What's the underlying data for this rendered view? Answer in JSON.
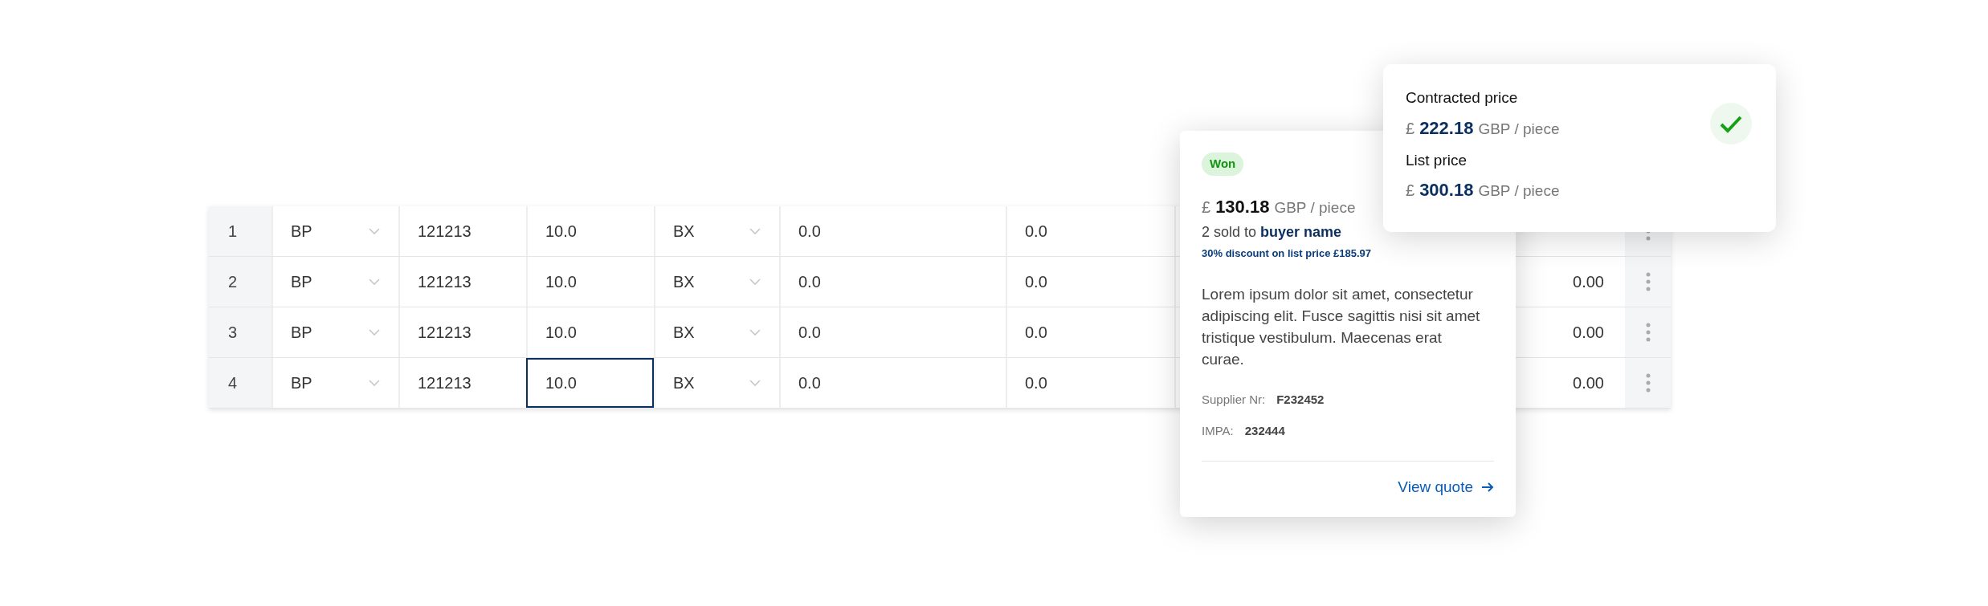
{
  "table": {
    "rows": [
      {
        "number": "1",
        "unit": "BP",
        "code": "121213",
        "quantity": "10.0",
        "quantity_focused": false,
        "pack": "BX",
        "column_6": "0.0",
        "column_7": "0.0"
      },
      {
        "number": "2",
        "unit": "BP",
        "code": "121213",
        "quantity": "10.0",
        "quantity_focused": false,
        "pack": "BX",
        "column_6": "0.0",
        "column_7": "0.0",
        "total": "0.00"
      },
      {
        "number": "3",
        "unit": "BP",
        "code": "121213",
        "quantity": "10.0",
        "quantity_focused": false,
        "pack": "BX",
        "column_6": "0.0",
        "column_7": "0.0",
        "total": "0.00"
      },
      {
        "number": "4",
        "unit": "BP",
        "code": "121213",
        "quantity": "10.0",
        "quantity_focused": true,
        "pack": "BX",
        "column_6": "0.0",
        "column_7": "0.0",
        "total": "0.00"
      }
    ]
  },
  "quote_card": {
    "status": "Won",
    "currency": "£",
    "price": "130.18",
    "unit": "GBP / piece",
    "sold": "2 sold to **buyer name**",
    "discount": "30% discount on list price £185.97",
    "description": "Lorem ipsum dolor sit amet, consectetur adipiscing elit. Fusce sagittis nisi sit amet tristique vestibulum. Maecenas erat curae.",
    "details": [
      {
        "label": "Supplier Nr:",
        "value": "F232452"
      },
      {
        "label": "IMPA:",
        "value": "232444"
      }
    ],
    "link": "View quote"
  },
  "price_card": {
    "confirmed": true,
    "prices": [
      {
        "label": "Contracted price",
        "currency": "£",
        "amount": "222.18",
        "unit": "GBP / piece"
      },
      {
        "label": "List price",
        "currency": "£",
        "amount": "300.18",
        "unit": "GBP / piece"
      }
    ]
  }
}
